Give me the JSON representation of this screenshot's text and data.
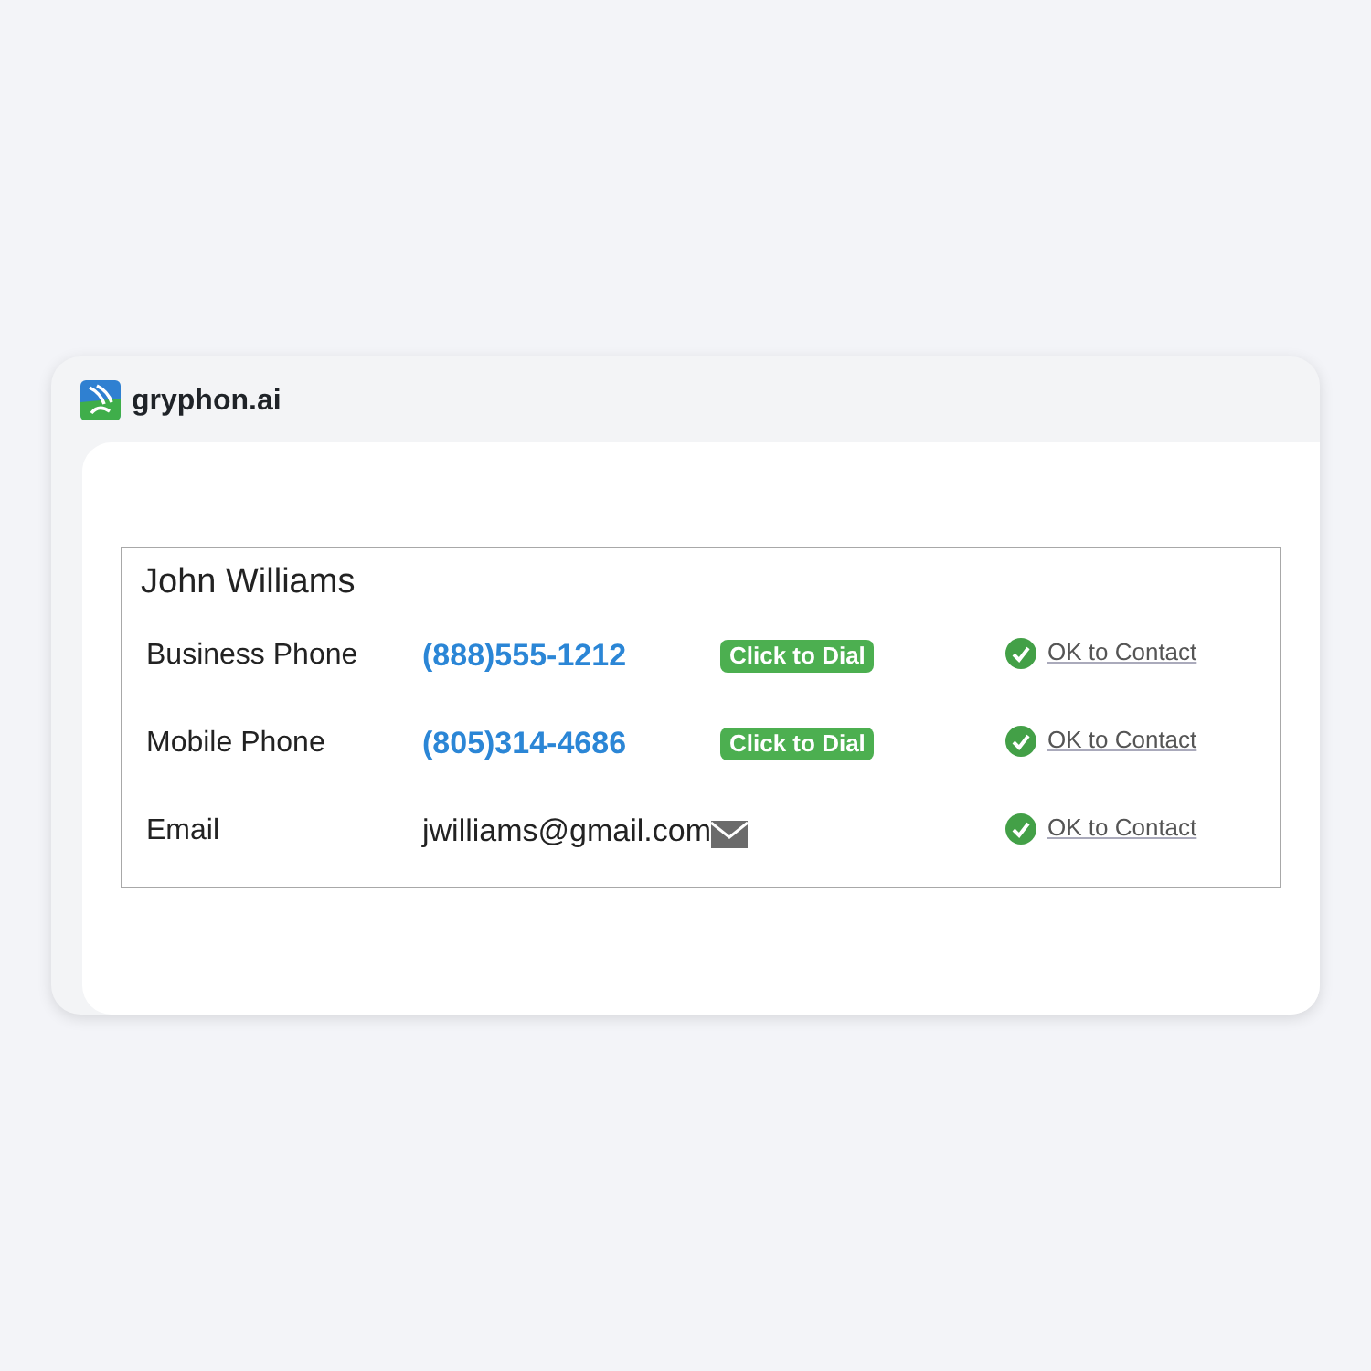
{
  "app": {
    "brand": "gryphon.ai"
  },
  "contact": {
    "name": "John Williams",
    "rows": [
      {
        "kind": "phone",
        "label": "Business Phone",
        "value": "(888)555-1212",
        "action": "Click to Dial",
        "status": "OK to Contact"
      },
      {
        "kind": "phone",
        "label": "Mobile Phone",
        "value": "(805)314-4686",
        "action": "Click to Dial",
        "status": "OK to Contact"
      },
      {
        "kind": "email",
        "label": "Email",
        "value": "jwilliams@gmail.com",
        "status": "OK to Contact"
      }
    ]
  }
}
